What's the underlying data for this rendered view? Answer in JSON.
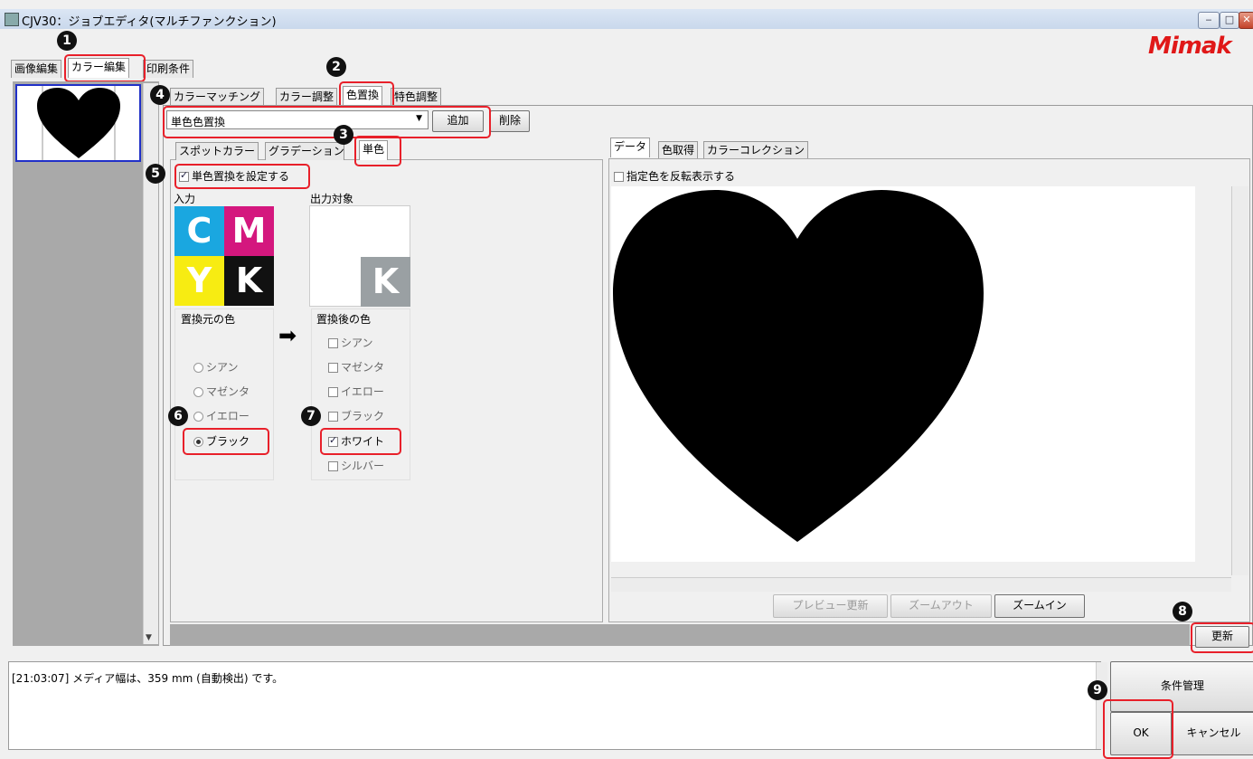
{
  "window": {
    "title": "CJV30：ジョブエディタ(マルチファンクション)",
    "minimize": "‒",
    "maximize": "□",
    "close": "✕"
  },
  "logo": "Mimak",
  "main_tabs": [
    "画像編集",
    "カラー編集",
    "印刷条件"
  ],
  "sub_tabs": [
    "カラーマッチング",
    "カラー調整",
    "色置換",
    "特色調整"
  ],
  "replace_type": {
    "value": "単色色置換",
    "add": "追加",
    "delete": "削除"
  },
  "mode_tabs": [
    "スポットカラー",
    "グラデーション",
    "単色"
  ],
  "single": {
    "enable_label": "単色置換を設定する",
    "input_label": "入力",
    "output_label": "出力対象",
    "inks_input": [
      "C",
      "M",
      "Y",
      "K"
    ],
    "ink_output": "K",
    "source_group": "置換元の色",
    "target_group": "置換後の色",
    "arrow": "➡",
    "source_options": [
      "シアン",
      "マゼンタ",
      "イエロー",
      "ブラック"
    ],
    "source_selected": "ブラック",
    "target_options": [
      "シアン",
      "マゼンタ",
      "イエロー",
      "ブラック",
      "ホワイト",
      "シルバー"
    ],
    "target_checked": "ホワイト"
  },
  "preview_tabs": [
    "データ",
    "色取得",
    "カラーコレクション"
  ],
  "preview": {
    "invert_label": "指定色を反転表示する",
    "refresh": "プレビュー更新",
    "zoom_out": "ズームアウト",
    "zoom_in": "ズームイン"
  },
  "update_button": "更新",
  "log": "[21:03:07] メディア幅は、359 mm (自動検出) です。",
  "footer": {
    "manage": "条件管理",
    "ok": "OK",
    "cancel": "キャンセル"
  },
  "badges": [
    "1",
    "2",
    "3",
    "4",
    "5",
    "6",
    "7",
    "8",
    "9"
  ],
  "colors": {
    "cyan": "#1aa7e0",
    "magenta": "#d4177e",
    "yellow": "#f7ec12",
    "black": "#111111",
    "gray_k": "#9aa0a3",
    "highlight": "#e8202a"
  }
}
